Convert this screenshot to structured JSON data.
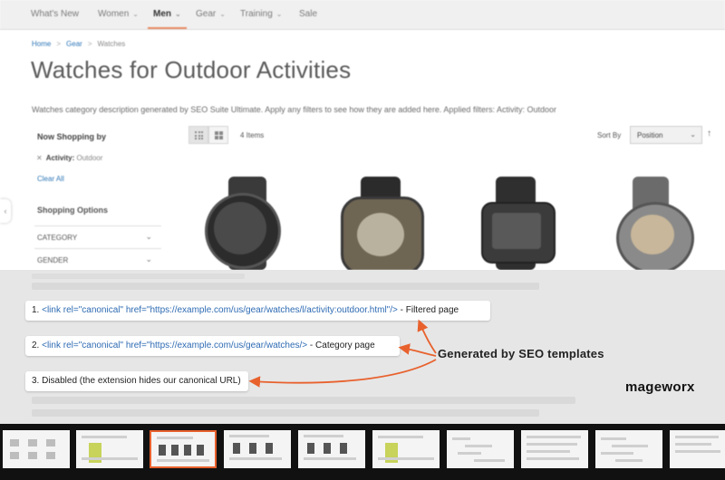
{
  "nav": {
    "items": [
      {
        "label": "What's New",
        "has_menu": false
      },
      {
        "label": "Women",
        "has_menu": true
      },
      {
        "label": "Men",
        "has_menu": true,
        "active": true
      },
      {
        "label": "Gear",
        "has_menu": true
      },
      {
        "label": "Training",
        "has_menu": true
      },
      {
        "label": "Sale",
        "has_menu": false
      }
    ],
    "active_color": "#e98a60"
  },
  "breadcrumb": {
    "home": "Home",
    "gear": "Gear",
    "current": "Watches"
  },
  "page": {
    "title": "Watches for Outdoor Activities",
    "description": "Watches category description generated by SEO Suite Ultimate. Apply any filters to see how they are added here. Applied filters: Activity: Outdoor"
  },
  "sidebar": {
    "now_shopping": "Now Shopping by",
    "filter_name": "Activity:",
    "filter_value": "Outdoor",
    "clear_all": "Clear All",
    "shopping_options": "Shopping Options",
    "options": [
      "CATEGORY",
      "GENDER"
    ]
  },
  "toolbar": {
    "items_count": "4 Items",
    "sort_label": "Sort By",
    "sort_value": "Position",
    "view_modes": [
      "grid",
      "list"
    ],
    "active_view": "grid"
  },
  "callouts": {
    "c1_prefix": "1. ",
    "c1_code": "<link rel=\"canonical\" href=\"https://example.com/us/gear/watches/l/activity:outdoor.html\"/>",
    "c1_suffix": " - Filtered page",
    "c2_prefix": "2. ",
    "c2_code": "<link rel=\"canonical\" href=\"https://example.com/us/gear/watches/>",
    "c2_suffix": " - Category page",
    "c3": "3. Disabled (the extension hides our canonical URL)",
    "generated_label": "Generated by SEO templates",
    "arrow_color": "#e8612d",
    "code_color": "#2e6bb3"
  },
  "brand": {
    "name": "mageworx"
  },
  "filmstrip": {
    "count": 10,
    "active_index": 2,
    "active_color": "#e8612d"
  }
}
